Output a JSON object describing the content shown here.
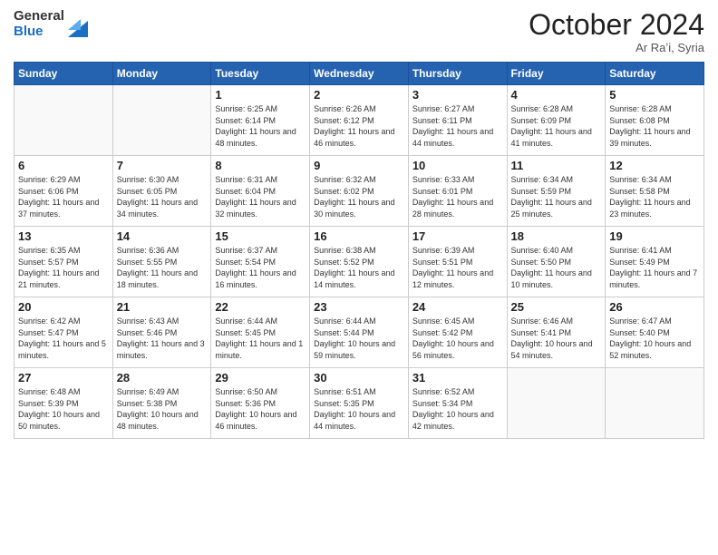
{
  "header": {
    "logo_general": "General",
    "logo_blue": "Blue",
    "month_title": "October 2024",
    "location": "Ar Raʼi, Syria"
  },
  "weekdays": [
    "Sunday",
    "Monday",
    "Tuesday",
    "Wednesday",
    "Thursday",
    "Friday",
    "Saturday"
  ],
  "weeks": [
    [
      {
        "day": "",
        "sunrise": "",
        "sunset": "",
        "daylight": ""
      },
      {
        "day": "",
        "sunrise": "",
        "sunset": "",
        "daylight": ""
      },
      {
        "day": "1",
        "sunrise": "Sunrise: 6:25 AM",
        "sunset": "Sunset: 6:14 PM",
        "daylight": "Daylight: 11 hours and 48 minutes."
      },
      {
        "day": "2",
        "sunrise": "Sunrise: 6:26 AM",
        "sunset": "Sunset: 6:12 PM",
        "daylight": "Daylight: 11 hours and 46 minutes."
      },
      {
        "day": "3",
        "sunrise": "Sunrise: 6:27 AM",
        "sunset": "Sunset: 6:11 PM",
        "daylight": "Daylight: 11 hours and 44 minutes."
      },
      {
        "day": "4",
        "sunrise": "Sunrise: 6:28 AM",
        "sunset": "Sunset: 6:09 PM",
        "daylight": "Daylight: 11 hours and 41 minutes."
      },
      {
        "day": "5",
        "sunrise": "Sunrise: 6:28 AM",
        "sunset": "Sunset: 6:08 PM",
        "daylight": "Daylight: 11 hours and 39 minutes."
      }
    ],
    [
      {
        "day": "6",
        "sunrise": "Sunrise: 6:29 AM",
        "sunset": "Sunset: 6:06 PM",
        "daylight": "Daylight: 11 hours and 37 minutes."
      },
      {
        "day": "7",
        "sunrise": "Sunrise: 6:30 AM",
        "sunset": "Sunset: 6:05 PM",
        "daylight": "Daylight: 11 hours and 34 minutes."
      },
      {
        "day": "8",
        "sunrise": "Sunrise: 6:31 AM",
        "sunset": "Sunset: 6:04 PM",
        "daylight": "Daylight: 11 hours and 32 minutes."
      },
      {
        "day": "9",
        "sunrise": "Sunrise: 6:32 AM",
        "sunset": "Sunset: 6:02 PM",
        "daylight": "Daylight: 11 hours and 30 minutes."
      },
      {
        "day": "10",
        "sunrise": "Sunrise: 6:33 AM",
        "sunset": "Sunset: 6:01 PM",
        "daylight": "Daylight: 11 hours and 28 minutes."
      },
      {
        "day": "11",
        "sunrise": "Sunrise: 6:34 AM",
        "sunset": "Sunset: 5:59 PM",
        "daylight": "Daylight: 11 hours and 25 minutes."
      },
      {
        "day": "12",
        "sunrise": "Sunrise: 6:34 AM",
        "sunset": "Sunset: 5:58 PM",
        "daylight": "Daylight: 11 hours and 23 minutes."
      }
    ],
    [
      {
        "day": "13",
        "sunrise": "Sunrise: 6:35 AM",
        "sunset": "Sunset: 5:57 PM",
        "daylight": "Daylight: 11 hours and 21 minutes."
      },
      {
        "day": "14",
        "sunrise": "Sunrise: 6:36 AM",
        "sunset": "Sunset: 5:55 PM",
        "daylight": "Daylight: 11 hours and 18 minutes."
      },
      {
        "day": "15",
        "sunrise": "Sunrise: 6:37 AM",
        "sunset": "Sunset: 5:54 PM",
        "daylight": "Daylight: 11 hours and 16 minutes."
      },
      {
        "day": "16",
        "sunrise": "Sunrise: 6:38 AM",
        "sunset": "Sunset: 5:52 PM",
        "daylight": "Daylight: 11 hours and 14 minutes."
      },
      {
        "day": "17",
        "sunrise": "Sunrise: 6:39 AM",
        "sunset": "Sunset: 5:51 PM",
        "daylight": "Daylight: 11 hours and 12 minutes."
      },
      {
        "day": "18",
        "sunrise": "Sunrise: 6:40 AM",
        "sunset": "Sunset: 5:50 PM",
        "daylight": "Daylight: 11 hours and 10 minutes."
      },
      {
        "day": "19",
        "sunrise": "Sunrise: 6:41 AM",
        "sunset": "Sunset: 5:49 PM",
        "daylight": "Daylight: 11 hours and 7 minutes."
      }
    ],
    [
      {
        "day": "20",
        "sunrise": "Sunrise: 6:42 AM",
        "sunset": "Sunset: 5:47 PM",
        "daylight": "Daylight: 11 hours and 5 minutes."
      },
      {
        "day": "21",
        "sunrise": "Sunrise: 6:43 AM",
        "sunset": "Sunset: 5:46 PM",
        "daylight": "Daylight: 11 hours and 3 minutes."
      },
      {
        "day": "22",
        "sunrise": "Sunrise: 6:44 AM",
        "sunset": "Sunset: 5:45 PM",
        "daylight": "Daylight: 11 hours and 1 minute."
      },
      {
        "day": "23",
        "sunrise": "Sunrise: 6:44 AM",
        "sunset": "Sunset: 5:44 PM",
        "daylight": "Daylight: 10 hours and 59 minutes."
      },
      {
        "day": "24",
        "sunrise": "Sunrise: 6:45 AM",
        "sunset": "Sunset: 5:42 PM",
        "daylight": "Daylight: 10 hours and 56 minutes."
      },
      {
        "day": "25",
        "sunrise": "Sunrise: 6:46 AM",
        "sunset": "Sunset: 5:41 PM",
        "daylight": "Daylight: 10 hours and 54 minutes."
      },
      {
        "day": "26",
        "sunrise": "Sunrise: 6:47 AM",
        "sunset": "Sunset: 5:40 PM",
        "daylight": "Daylight: 10 hours and 52 minutes."
      }
    ],
    [
      {
        "day": "27",
        "sunrise": "Sunrise: 6:48 AM",
        "sunset": "Sunset: 5:39 PM",
        "daylight": "Daylight: 10 hours and 50 minutes."
      },
      {
        "day": "28",
        "sunrise": "Sunrise: 6:49 AM",
        "sunset": "Sunset: 5:38 PM",
        "daylight": "Daylight: 10 hours and 48 minutes."
      },
      {
        "day": "29",
        "sunrise": "Sunrise: 6:50 AM",
        "sunset": "Sunset: 5:36 PM",
        "daylight": "Daylight: 10 hours and 46 minutes."
      },
      {
        "day": "30",
        "sunrise": "Sunrise: 6:51 AM",
        "sunset": "Sunset: 5:35 PM",
        "daylight": "Daylight: 10 hours and 44 minutes."
      },
      {
        "day": "31",
        "sunrise": "Sunrise: 6:52 AM",
        "sunset": "Sunset: 5:34 PM",
        "daylight": "Daylight: 10 hours and 42 minutes."
      },
      {
        "day": "",
        "sunrise": "",
        "sunset": "",
        "daylight": ""
      },
      {
        "day": "",
        "sunrise": "",
        "sunset": "",
        "daylight": ""
      }
    ]
  ]
}
